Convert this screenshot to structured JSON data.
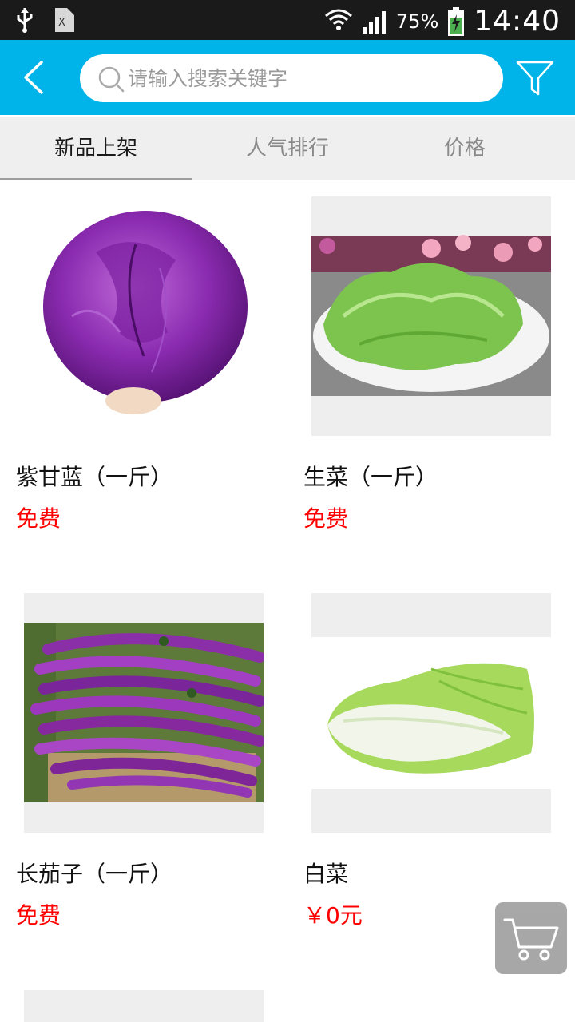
{
  "status_bar": {
    "battery": "75%",
    "time": "14:40"
  },
  "search": {
    "placeholder": "请输入搜索关键字"
  },
  "tabs": [
    {
      "label": "新品上架",
      "active": true
    },
    {
      "label": "人气排行",
      "active": false
    },
    {
      "label": "价格",
      "active": false
    }
  ],
  "products": [
    {
      "name": "紫甘蓝（一斤）",
      "price": "免费",
      "image": "purple-cabbage"
    },
    {
      "name": "生菜（一斤）",
      "price": "免费",
      "image": "lettuce"
    },
    {
      "name": "长茄子（一斤）",
      "price": "免费",
      "image": "long-eggplant"
    },
    {
      "name": "白菜",
      "price": "￥0元",
      "image": "napa-cabbage"
    }
  ],
  "colors": {
    "header": "#00b4ea",
    "price": "#ff0000",
    "tab_bg": "#efefef"
  }
}
